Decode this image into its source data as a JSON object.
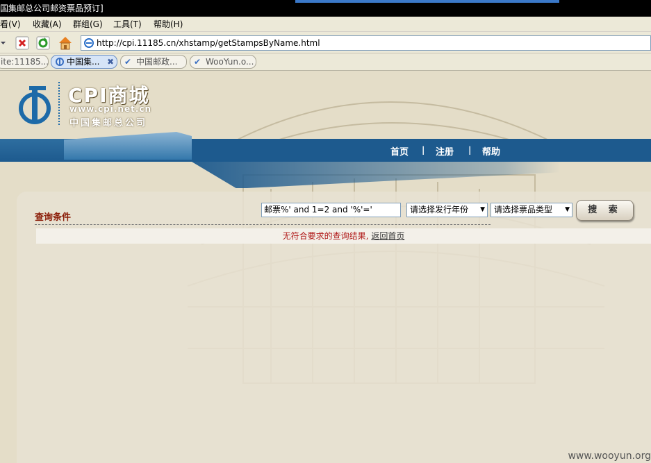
{
  "window": {
    "title": "国集邮总公司邮资票品预订]"
  },
  "menu": {
    "items": [
      "看(V)",
      "收藏(A)",
      "群组(G)",
      "工具(T)",
      "帮助(H)"
    ]
  },
  "address": {
    "url": "http://cpi.11185.cn/xhstamp/getStampsByName.html"
  },
  "tabs": [
    {
      "label": "ite:11185...",
      "active": false
    },
    {
      "label": "中国集...",
      "active": true
    },
    {
      "label": "中国邮政...",
      "active": false
    },
    {
      "label": "WooYun.o...",
      "active": false
    }
  ],
  "logo": {
    "brand": "CPI商城",
    "url": "www.cpi.net.cn",
    "company": "中国集邮总公司"
  },
  "nav": {
    "home": "首页",
    "register": "注册",
    "help": "帮助",
    "separator": "|"
  },
  "query": {
    "title": "查询条件",
    "keyword_value": "邮票%' and 1=2 and '%'='",
    "year_select": "请选择发行年份",
    "type_select": "请选择票品类型",
    "search_button": "搜 索"
  },
  "result": {
    "message": "无符合要求的查询结果,",
    "back_link": "返回首页"
  },
  "watermark": "www.wooyun.org",
  "colors": {
    "nav_blue": "#1d5a8e",
    "title_red": "#8b1d08",
    "result_red": "#b01818"
  }
}
